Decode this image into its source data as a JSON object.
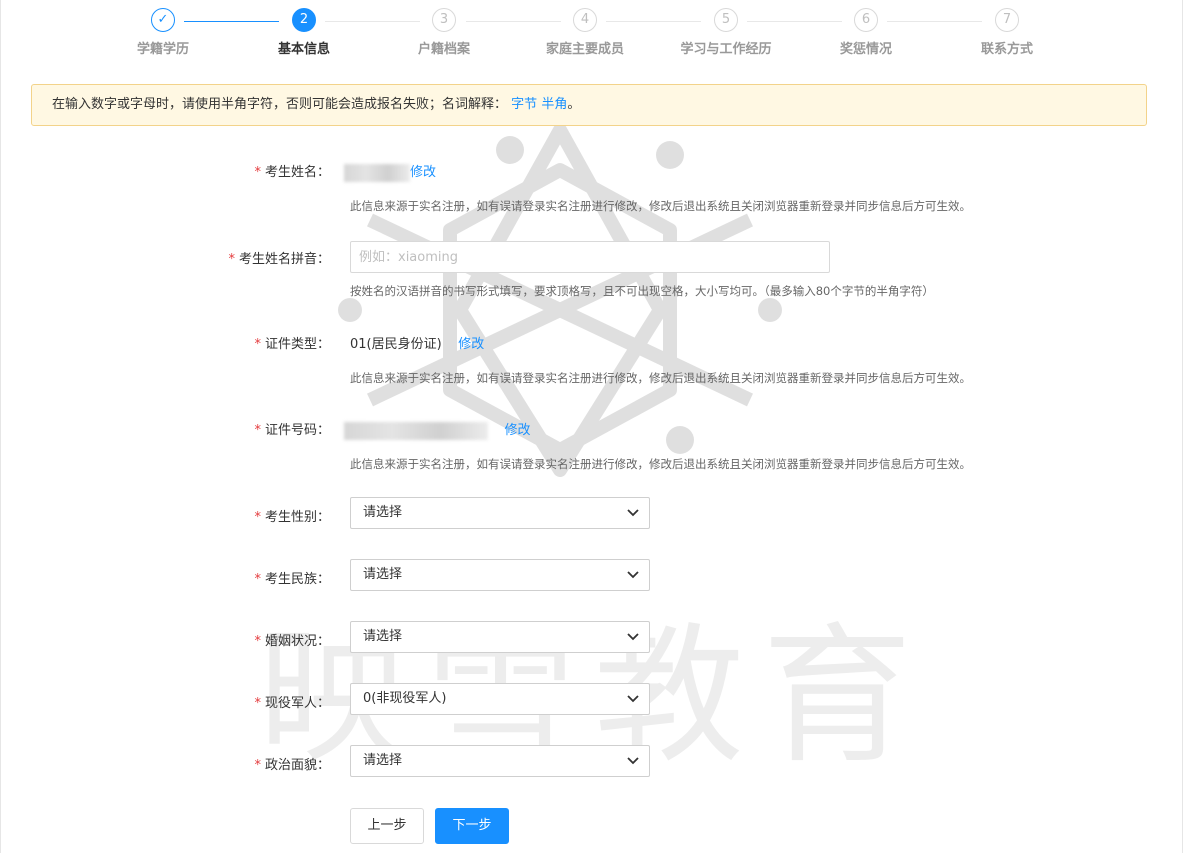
{
  "steps": [
    {
      "num": "✓",
      "label": "学籍学历",
      "state": "done"
    },
    {
      "num": "2",
      "label": "基本信息",
      "state": "active"
    },
    {
      "num": "3",
      "label": "户籍档案",
      "state": "todo"
    },
    {
      "num": "4",
      "label": "家庭主要成员",
      "state": "todo"
    },
    {
      "num": "5",
      "label": "学习与工作经历",
      "state": "todo"
    },
    {
      "num": "6",
      "label": "奖惩情况",
      "state": "todo"
    },
    {
      "num": "7",
      "label": "联系方式",
      "state": "todo"
    }
  ],
  "notice": {
    "text": "在输入数字或字母时，请使用半角字符，否则可能会造成报名失败；名词解释：",
    "link1": "字节",
    "link2": "半角",
    "suffix": "。"
  },
  "form": {
    "name": {
      "label": "考生姓名：",
      "edit": "修改",
      "hint": "此信息来源于实名注册，如有误请登录实名注册进行修改，修改后退出系统且关闭浏览器重新登录并同步信息后方可生效。"
    },
    "pinyin": {
      "label": "考生姓名拼音：",
      "placeholder": "例如：xiaoming",
      "value": "",
      "hint": "按姓名的汉语拼音的书写形式填写，要求顶格写，且不可出现空格，大小写均可。（最多输入80个字节的半角字符）"
    },
    "id_type": {
      "label": "证件类型：",
      "value": "01(居民身份证)",
      "edit": "修改",
      "hint": "此信息来源于实名注册，如有误请登录实名注册进行修改，修改后退出系统且关闭浏览器重新登录并同步信息后方可生效。"
    },
    "id_number": {
      "label": "证件号码：",
      "edit": "修改",
      "hint": "此信息来源于实名注册，如有误请登录实名注册进行修改，修改后退出系统且关闭浏览器重新登录并同步信息后方可生效。"
    },
    "gender": {
      "label": "考生性别：",
      "value": "请选择"
    },
    "ethnicity": {
      "label": "考生民族：",
      "value": "请选择"
    },
    "marital": {
      "label": "婚姻状况：",
      "value": "请选择"
    },
    "military": {
      "label": "现役军人：",
      "value": "0(非现役军人)"
    },
    "political": {
      "label": "政治面貌：",
      "value": "请选择"
    }
  },
  "buttons": {
    "prev": "上一步",
    "next": "下一步"
  },
  "watermark": "映雪教育",
  "colors": {
    "accent": "#1890ff",
    "required": "#e4393c",
    "notice_bg": "#fff8e3",
    "notice_border": "#f3d38a"
  }
}
